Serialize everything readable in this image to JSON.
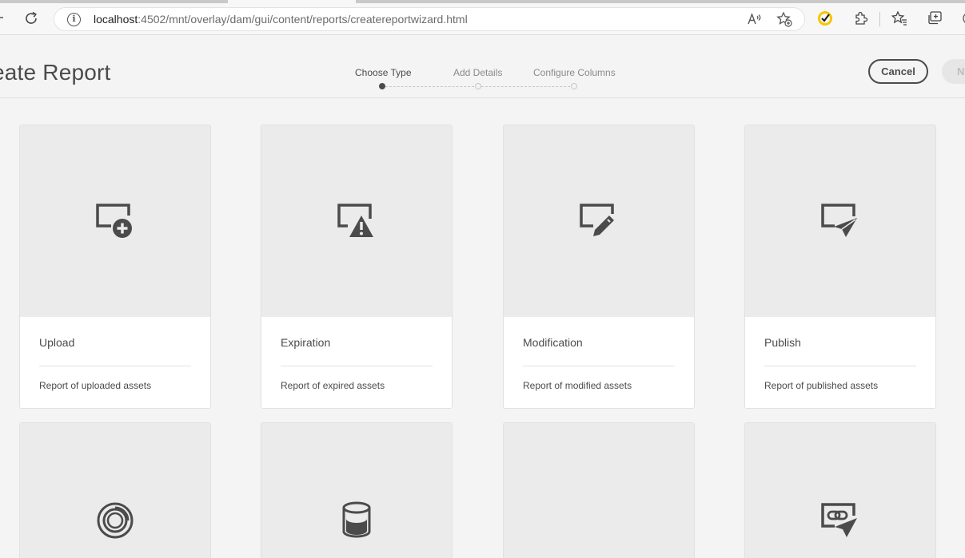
{
  "browser": {
    "url_host": "localhost",
    "url_path": ":4502/mnt/overlay/dam/gui/content/reports/createreportwizard.html",
    "icons": [
      "back-arrow-icon",
      "reload-icon",
      "info-icon",
      "read-aloud-icon",
      "add-favorite-icon",
      "norton-check-icon",
      "extensions-icon",
      "favorites-icon",
      "collections-icon"
    ]
  },
  "header": {
    "title": "eate Report",
    "cancel_label": "Cancel",
    "next_label": "N"
  },
  "steps": [
    {
      "label": "Choose Type",
      "active": true
    },
    {
      "label": "Add Details",
      "active": false
    },
    {
      "label": "Configure Columns",
      "active": false
    }
  ],
  "cards": [
    {
      "title": "Upload",
      "description": "Report of uploaded assets",
      "icon": "upload-report-icon"
    },
    {
      "title": "Expiration",
      "description": "Report of expired assets",
      "icon": "expiration-report-icon"
    },
    {
      "title": "Modification",
      "description": "Report of modified assets",
      "icon": "modification-report-icon"
    },
    {
      "title": "Publish",
      "description": "Report of published assets",
      "icon": "publish-report-icon"
    },
    {
      "icon": "disk-usage-report-icon"
    },
    {
      "icon": "storage-report-icon"
    },
    {
      "icon": ""
    },
    {
      "icon": "link-share-report-icon"
    }
  ],
  "colors": {
    "icon": "#4b4b4b",
    "thumb_bg": "#ebebeb",
    "page_bg": "#f4f4f4",
    "norton_yellow": "#f7c500"
  }
}
